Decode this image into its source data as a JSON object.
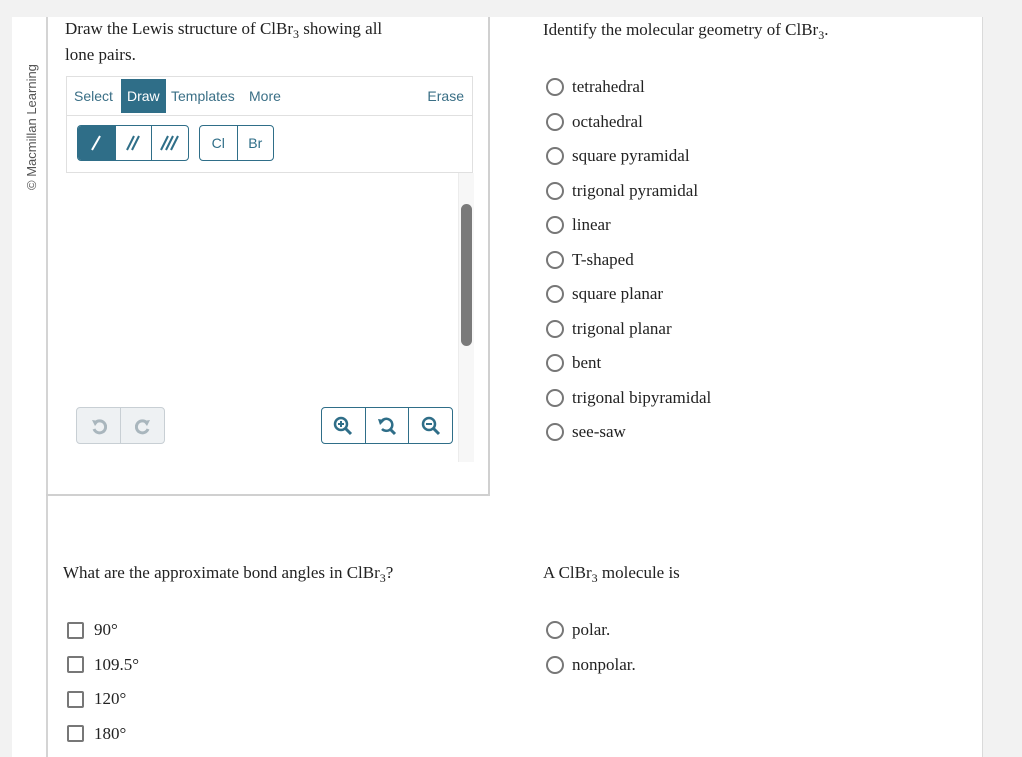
{
  "brand": {
    "copyright": "© Macmillan Learning"
  },
  "q1": {
    "prompt_before": "Draw the Lewis structure of ClBr",
    "prompt_sub": "3",
    "prompt_after": " showing all",
    "prompt_line2": "lone pairs.",
    "editor": {
      "tabs": [
        "Select",
        "Draw",
        "Templates",
        "More"
      ],
      "active_tab": "Draw",
      "erase_label": "Erase",
      "bond_tools": [
        {
          "name": "single-bond",
          "glyph": "/"
        },
        {
          "name": "double-bond",
          "glyph": "//"
        },
        {
          "name": "triple-bond",
          "glyph": "///"
        }
      ],
      "atoms": [
        "Cl",
        "Br"
      ],
      "undo_icon": "undo-icon",
      "redo_icon": "redo-icon",
      "zoom_in_icon": "zoom-in-icon",
      "reset_zoom_icon": "reset-zoom-icon",
      "zoom_out_icon": "zoom-out-icon"
    }
  },
  "q2": {
    "prompt_before": "Identify the molecular geometry of ClBr",
    "prompt_sub": "3",
    "prompt_after": ".",
    "options": [
      "tetrahedral",
      "octahedral",
      "square pyramidal",
      "trigonal pyramidal",
      "linear",
      "T-shaped",
      "square planar",
      "trigonal planar",
      "bent",
      "trigonal bipyramidal",
      "see-saw"
    ]
  },
  "q3": {
    "prompt_before": "What are the approximate bond angles in ClBr",
    "prompt_sub": "3",
    "prompt_after": "?",
    "options": [
      "90°",
      "109.5°",
      "120°",
      "180°"
    ]
  },
  "q4": {
    "prompt_before": "A ClBr",
    "prompt_sub": "3",
    "prompt_after": " molecule is",
    "options": [
      "polar.",
      "nonpolar."
    ]
  },
  "colors": {
    "accent": "#2f6e88",
    "disabled": "#c8cfd4"
  }
}
